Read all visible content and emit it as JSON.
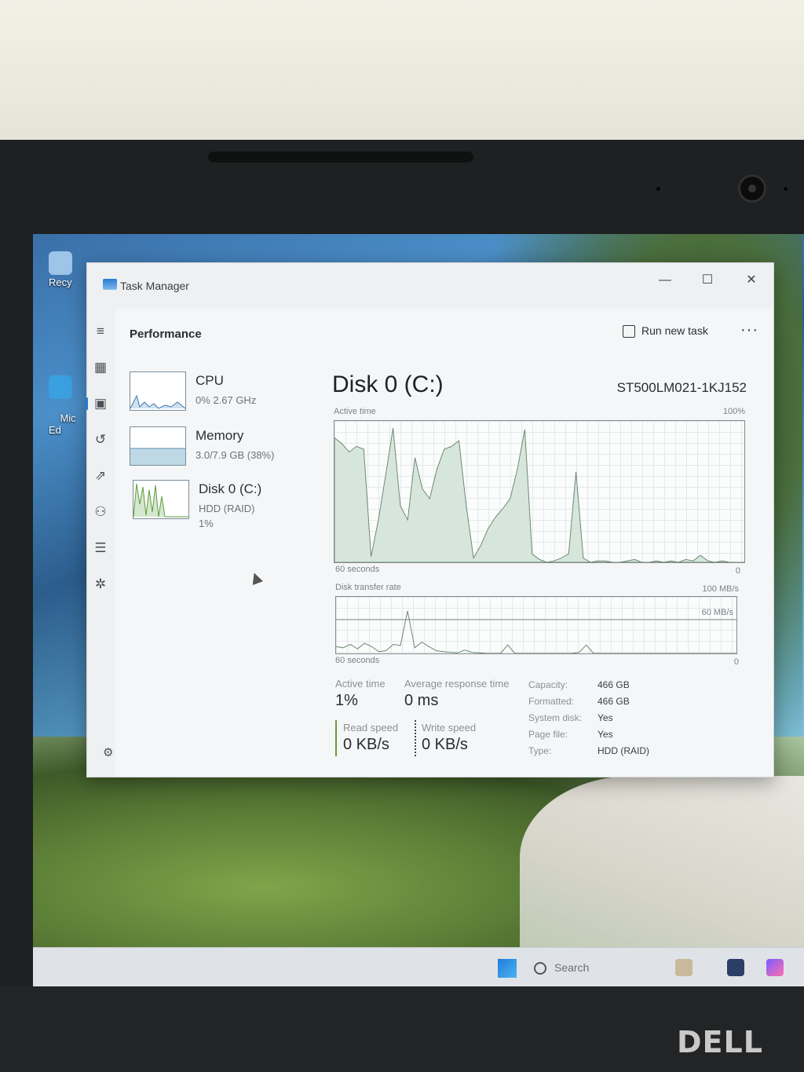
{
  "window": {
    "title": "Task Manager",
    "minimize_glyph": "—",
    "maximize_glyph": "☐",
    "close_glyph": "✕"
  },
  "header": {
    "page_title": "Performance",
    "run_new_task": "Run new task",
    "more_glyph": "···"
  },
  "nav_icons": [
    "hamburger-icon",
    "processes-icon",
    "performance-icon",
    "app-history-icon",
    "startup-apps-icon",
    "users-icon",
    "details-icon",
    "services-icon",
    "settings-icon"
  ],
  "sidebar": {
    "items": [
      {
        "name": "CPU",
        "sub1": "0%  2.67 GHz",
        "sub2": ""
      },
      {
        "name": "Memory",
        "sub1": "3.0/7.9 GB (38%)",
        "sub2": ""
      },
      {
        "name": "Disk 0 (C:)",
        "sub1": "HDD (RAID)",
        "sub2": "1%"
      }
    ]
  },
  "disk": {
    "title": "Disk 0 (C:)",
    "model": "ST500LM021-1KJ152",
    "active_time_label": "Active time",
    "active_time_max": "100%",
    "active_time_x_label": "60 seconds",
    "active_time_min": "0",
    "transfer_label": "Disk transfer rate",
    "transfer_max": "100 MB/s",
    "transfer_mid": "60 MB/s",
    "transfer_x_label": "60 seconds",
    "transfer_min": "0",
    "active_time_series": [
      88,
      84,
      78,
      82,
      80,
      4,
      30,
      62,
      95,
      40,
      30,
      74,
      52,
      45,
      66,
      80,
      82,
      86,
      40,
      3,
      12,
      24,
      32,
      38,
      45,
      66,
      94,
      6,
      2,
      0,
      1,
      3,
      6,
      64,
      3,
      0,
      1,
      1,
      0,
      0,
      1,
      2,
      0,
      0,
      1,
      0,
      1,
      0,
      2,
      1,
      5,
      1,
      0,
      1,
      0,
      0,
      0
    ],
    "transfer_series": [
      12,
      10,
      16,
      8,
      18,
      12,
      3,
      5,
      16,
      14,
      75,
      10,
      20,
      12,
      5,
      3,
      2,
      1,
      6,
      2,
      1,
      0,
      0,
      0,
      15,
      0,
      0,
      0,
      0,
      0,
      0,
      0,
      0,
      0,
      2,
      15,
      0,
      0,
      0,
      0,
      0,
      0,
      0,
      0,
      0,
      0,
      0,
      0,
      0,
      0,
      0,
      0,
      0,
      0,
      0,
      0,
      0
    ],
    "stats": {
      "active_time": {
        "label": "Active time",
        "value": "1%"
      },
      "avg_response": {
        "label": "Average response time",
        "value": "0 ms"
      },
      "read_speed": {
        "label": "Read speed",
        "value": "0 KB/s"
      },
      "write_speed": {
        "label": "Write speed",
        "value": "0 KB/s"
      }
    },
    "properties": [
      {
        "key": "Capacity:",
        "value": "466 GB"
      },
      {
        "key": "Formatted:",
        "value": "466 GB"
      },
      {
        "key": "System disk:",
        "value": "Yes"
      },
      {
        "key": "Page file:",
        "value": "Yes"
      },
      {
        "key": "Type:",
        "value": "HDD (RAID)"
      }
    ]
  },
  "desktop": {
    "icons": [
      {
        "label": "Recy"
      },
      {
        "label": "Mic\nEd"
      }
    ]
  },
  "taskbar": {
    "search_placeholder": "Search"
  },
  "laptop": {
    "brand": "DELL"
  },
  "colors": {
    "chart_stroke": "#6f8a73",
    "chart_fill": "#d7e6dc",
    "accent": "#2b78c8"
  }
}
